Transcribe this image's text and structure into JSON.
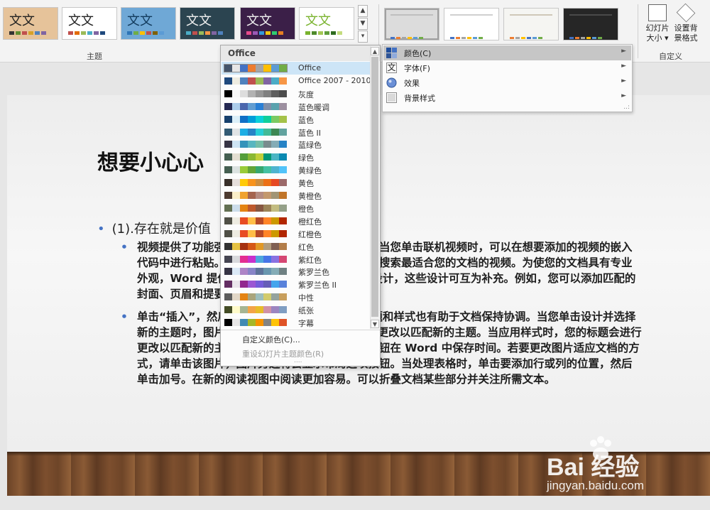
{
  "ribbon": {
    "theme_thumbs": [
      {
        "text": "文文",
        "text_color": "#222222",
        "bg": "#e6c39a",
        "bars": [
          "#333333",
          "#5e8c31",
          "#c0504d",
          "#d6a228",
          "#4f81bd",
          "#8064a2"
        ]
      },
      {
        "text": "文文",
        "text_color": "#222222",
        "bg": "#ffffff",
        "bars": [
          "#c0504d",
          "#e36c09",
          "#9bbb59",
          "#4bacc6",
          "#8064a2",
          "#1f497d"
        ]
      },
      {
        "text": "文文",
        "text_color": "#123a5c",
        "bg": "#6fa8d6",
        "bars": [
          "#2e75b6",
          "#70ad47",
          "#ffc000",
          "#c0504d",
          "#7f6000",
          "#5b9bd5"
        ]
      },
      {
        "text": "文文",
        "text_color": "#f0f0f0",
        "bg": "#2b4450",
        "bars": [
          "#4bacc6",
          "#c0504d",
          "#9bbb59",
          "#f79646",
          "#8064a2",
          "#4f81bd"
        ]
      },
      {
        "text": "文文",
        "text_color": "#f0f0f0",
        "bg": "#3b1f48",
        "bars": [
          "#e84a8c",
          "#9b59b6",
          "#3498db",
          "#f1c40f",
          "#2ecc71",
          "#e67e22"
        ]
      },
      {
        "text": "文文",
        "text_color": "#7ab32e",
        "bg": "#ffffff",
        "bars": [
          "#7ab32e",
          "#4e8a2a",
          "#a3c755",
          "#5f9c3a",
          "#2e6b1f",
          "#c4dc7e"
        ]
      }
    ],
    "themes_group_label": "主题",
    "variant_thumbs": [
      {
        "bg": "#dcdcdc",
        "line": "#bfbfbf",
        "dots": [
          "#4472c4",
          "#ed7d31",
          "#a5a5a5",
          "#ffc000",
          "#5b9bd5",
          "#70ad47"
        ]
      },
      {
        "bg": "#ffffff",
        "line": "#d0d0d0",
        "dots": [
          "#4472c4",
          "#ed7d31",
          "#a5a5a5",
          "#ffc000",
          "#5b9bd5",
          "#70ad47"
        ]
      },
      {
        "bg": "#f5f5f2",
        "line": "#cfc8b8",
        "dots": [
          "#ed7d31",
          "#a5a5a5",
          "#ffc000",
          "#4472c4",
          "#5b9bd5",
          "#70ad47"
        ]
      },
      {
        "bg": "#262626",
        "line": "#4a4a4a",
        "dots": [
          "#4472c4",
          "#ed7d31",
          "#a5a5a5",
          "#ffc000",
          "#5b9bd5",
          "#70ad47"
        ]
      }
    ],
    "slide_size_label": "幻灯片 大小",
    "slide_size_arrow": "▾",
    "bg_format_label": "设置背 景格式",
    "customize_group_label": "自定义"
  },
  "menu": {
    "header": "Office",
    "selected_index": 0,
    "items": [
      {
        "label": "Office",
        "colors": [
          "#44546a",
          "#e7e6e6",
          "#4472c4",
          "#ed7d31",
          "#a5a5a5",
          "#ffc000",
          "#5b9bd5",
          "#70ad47"
        ]
      },
      {
        "label": "Office 2007 - 2010",
        "colors": [
          "#1f497d",
          "#eeece1",
          "#4f81bd",
          "#c0504d",
          "#9bbb59",
          "#8064a2",
          "#4bacc6",
          "#f79646"
        ]
      },
      {
        "label": "灰度",
        "colors": [
          "#000000",
          "#f8f8f8",
          "#dddddd",
          "#b2b2b2",
          "#969696",
          "#808080",
          "#5f5f5f",
          "#4d4d4d"
        ]
      },
      {
        "label": "蓝色暖调",
        "colors": [
          "#242852",
          "#acccea",
          "#4a66ac",
          "#629dd1",
          "#297fd5",
          "#7f8fa9",
          "#5aa2ae",
          "#9d90a0"
        ]
      },
      {
        "label": "蓝色",
        "colors": [
          "#17406d",
          "#dbeff9",
          "#0f6fc6",
          "#009dd9",
          "#0bd0d9",
          "#10cf9b",
          "#7cca62",
          "#a5c249"
        ]
      },
      {
        "label": "蓝色 II",
        "colors": [
          "#335b74",
          "#dfe3e5",
          "#1cade4",
          "#2683c6",
          "#27ced7",
          "#42ba97",
          "#3e8853",
          "#62a39f"
        ]
      },
      {
        "label": "蓝绿色",
        "colors": [
          "#373545",
          "#cee4f4",
          "#3494ba",
          "#58b6c0",
          "#75bda7",
          "#7a8c8e",
          "#84acb6",
          "#2683c6"
        ]
      },
      {
        "label": "绿色",
        "colors": [
          "#455f51",
          "#e3ded1",
          "#549e39",
          "#8ab833",
          "#c0cf3a",
          "#029676",
          "#4ab5c4",
          "#0989b1"
        ]
      },
      {
        "label": "黄绿色",
        "colors": [
          "#455f51",
          "#dbe2e0",
          "#99cb38",
          "#63a537",
          "#37a76f",
          "#44c1a3",
          "#4eb3cf",
          "#51c3f9"
        ]
      },
      {
        "label": "黄色",
        "colors": [
          "#39302a",
          "#e5dedb",
          "#ffca08",
          "#f8931d",
          "#ce8d3e",
          "#ec7016",
          "#e64823",
          "#9c6a6a"
        ]
      },
      {
        "label": "黄橙色",
        "colors": [
          "#4e3b30",
          "#fbeec9",
          "#f0a22e",
          "#a5644e",
          "#b58b80",
          "#c3986d",
          "#a19574",
          "#c17529"
        ]
      },
      {
        "label": "橙色",
        "colors": [
          "#637052",
          "#ccddea",
          "#e48312",
          "#bd582c",
          "#865640",
          "#9b8357",
          "#c2bc80",
          "#94a088"
        ]
      },
      {
        "label": "橙红色",
        "colors": [
          "#505046",
          "#eeece1",
          "#e84c22",
          "#ffbd47",
          "#b64926",
          "#ff8427",
          "#cc9900",
          "#b22600"
        ]
      },
      {
        "label": "红橙色",
        "colors": [
          "#505046",
          "#eeece1",
          "#e84c22",
          "#ffbd47",
          "#b64926",
          "#ff8427",
          "#cc9900",
          "#b22600"
        ]
      },
      {
        "label": "红色",
        "colors": [
          "#323232",
          "#e5c243",
          "#a5300f",
          "#d55816",
          "#e19825",
          "#b19c7d",
          "#7f5f52",
          "#b27d49"
        ]
      },
      {
        "label": "紫红色",
        "colors": [
          "#454551",
          "#d8d9dc",
          "#e32d91",
          "#c830cc",
          "#4ea6dc",
          "#4775e7",
          "#8971e1",
          "#d54773"
        ]
      },
      {
        "label": "紫罗兰色",
        "colors": [
          "#373545",
          "#dceaf7",
          "#ad84c6",
          "#8784c7",
          "#5d739a",
          "#6997af",
          "#84acb6",
          "#6f8183"
        ]
      },
      {
        "label": "紫罗兰色 II",
        "colors": [
          "#632e62",
          "#eae5eb",
          "#92278f",
          "#9b57d3",
          "#755dd9",
          "#665eb8",
          "#45a5ed",
          "#5982db"
        ]
      },
      {
        "label": "中性",
        "colors": [
          "#5d5d5d",
          "#e2d7c7",
          "#e48312",
          "#a9a57c",
          "#9cbebd",
          "#d2cb6c",
          "#95a39d",
          "#c89f5d"
        ]
      },
      {
        "label": "纸张",
        "colors": [
          "#444d26",
          "#fefac9",
          "#a5b592",
          "#f3a447",
          "#e7bc29",
          "#d092a7",
          "#9c85c0",
          "#809ec2"
        ]
      },
      {
        "label": "字幕",
        "colors": [
          "#000000",
          "#e7e6e6",
          "#418ab3",
          "#a6b727",
          "#f69200",
          "#838383",
          "#fec306",
          "#df5327"
        ]
      }
    ],
    "custom_colors": "自定义颜色(C)...",
    "reset_colors": "重设幻灯片主题颜色(R)",
    "grip": "....",
    "scroll_up": "▲",
    "scroll_down": "▼"
  },
  "submenu": {
    "items": [
      {
        "label": "颜色(C)",
        "arrow": "►",
        "icon": "color-swatch-icon"
      },
      {
        "label": "字体(F)",
        "arrow": "►",
        "icon": "font-icon"
      },
      {
        "label": "效果",
        "arrow": "►",
        "icon": "effects-icon"
      },
      {
        "label": "背景样式",
        "arrow": "►",
        "icon": "background-style-icon"
      }
    ],
    "font_icon_glyph": "文",
    "grip": "..:"
  },
  "slide": {
    "title": "想要小心心",
    "bullet1": "(1).存在就是价值",
    "bullet_glyph": "•",
    "para1": "视频提供了功能强大的方法帮助您证明您的观点。当您单击联机视频时，可以在想要添加的视频的嵌入代码中进行粘贴。您也可以键入一个关键字以联机搜索最适合您的文档的视频。为使您的文档具有专业外观，Word 提供了页眉、页脚、封面和文本框设计，这些设计可互为补充。例如，您可以添加匹配的封面、页眉和提要栏。",
    "para2": "单击“插入”，然后从不同库中选择所需元素。主题和样式也有助于文档保持协调。当您单击设计并选择新的主题时，图片、图表或 SmartArt 图形将会更改以匹配新的主题。当应用样式时，您的标题会进行更改以匹配新的主题。使用在需要位置出现的新按钮在 Word 中保存时间。若要更改图片适应文档的方式，请单击该图片，图片旁边将会显示布局选项按钮。当处理表格时，单击要添加行或列的位置，然后单击加号。在新的阅读视图中阅读更加容易。可以折叠文档某些部分并关注所需文本。"
  },
  "watermark": {
    "brand": "Bai  经验",
    "url": "jingyan.baidu.com"
  },
  "colors": {
    "accent_blue": "#4472c4",
    "menu_highlight": "#cde5f7",
    "submenu_active": "#c6c6c6"
  }
}
